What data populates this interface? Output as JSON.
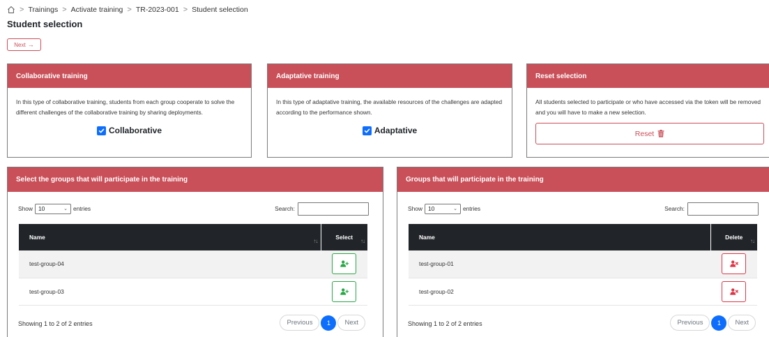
{
  "breadcrumb": {
    "items": [
      "Trainings",
      "Activate training",
      "TR-2023-001",
      "Student selection"
    ],
    "separator": ">"
  },
  "page": {
    "title": "Student selection",
    "next_label": "Next",
    "next_arrow": "→"
  },
  "cards": {
    "collaborative": {
      "title": "Collaborative training",
      "description": "In this type of collaborative training, students from each group cooperate to solve the different challenges of the collaborative training by sharing deployments.",
      "checkbox_label": "Collaborative",
      "checked": true
    },
    "adaptive": {
      "title": "Adaptative training",
      "description": "In this type of adaptative training, the available resources of the challenges are adapted according to the performance shown.",
      "checkbox_label": "Adaptative",
      "checked": true
    },
    "reset": {
      "title": "Reset selection",
      "description": "All students selected to participate or who have accessed via the token will be removed and you will have to make a new selection.",
      "button_label": "Reset"
    }
  },
  "available_groups": {
    "title": "Select the groups that will participate in the training",
    "show_label": "Show",
    "entries_value": "10",
    "entries_label": "entries",
    "search_label": "Search:",
    "columns": [
      "Name",
      "Select"
    ],
    "rows": [
      "test-group-04",
      "test-group-03"
    ],
    "info": "Showing 1 to 2 of 2 entries",
    "pagination": {
      "previous": "Previous",
      "current": "1",
      "next": "Next"
    }
  },
  "participating_groups": {
    "title": "Groups that will participate in the training",
    "show_label": "Show",
    "entries_value": "10",
    "entries_label": "entries",
    "search_label": "Search:",
    "columns": [
      "Name",
      "Delete"
    ],
    "rows": [
      "test-group-01",
      "test-group-02"
    ],
    "info": "Showing 1 to 2 of 2 entries",
    "pagination": {
      "previous": "Previous",
      "current": "1",
      "next": "Next"
    }
  },
  "icons": {
    "home": "home-icon",
    "check": "checkbox-checked-icon",
    "trash": "trash-icon",
    "add_user": "user-plus-icon",
    "remove_user": "user-x-icon",
    "sort": "sort-icon"
  },
  "colors": {
    "accent": "#c94f58",
    "primary": "#0d6efd",
    "success": "#28a745",
    "danger": "#dc3545",
    "table_header": "#212529"
  }
}
